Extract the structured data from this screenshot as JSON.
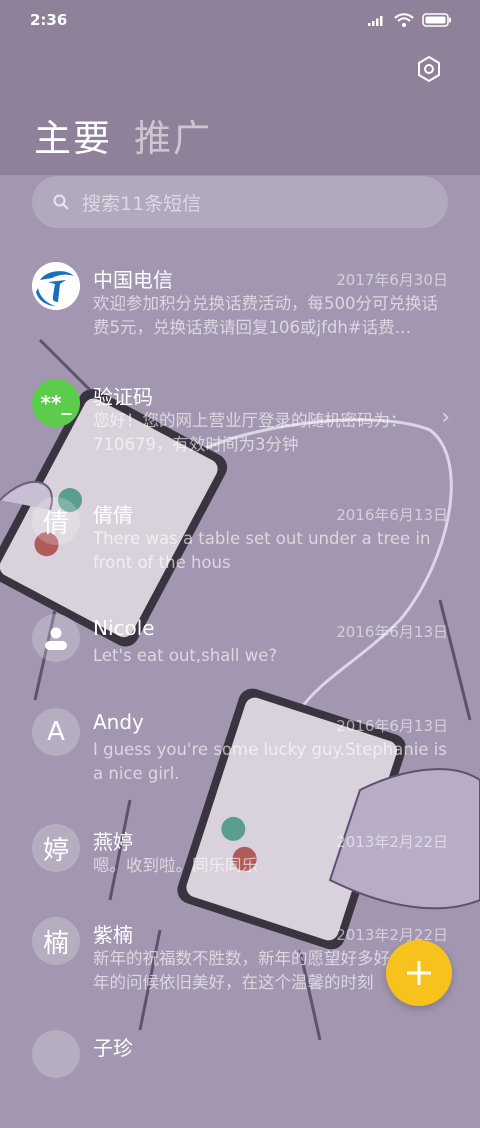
{
  "status_bar": {
    "time": "2:36"
  },
  "tabs": {
    "primary": "主要",
    "promo": "推广"
  },
  "search": {
    "placeholder": "搜索11条短信"
  },
  "conversations": [
    {
      "name": "中国电信",
      "date": "2017年6月30日",
      "preview": "欢迎参加积分兑换话费活动，每500分可兑换话费5元，兑换话费请回复106或jfdh#话费…",
      "avatar_icon": "china-telecom-logo"
    },
    {
      "name": "验证码",
      "date": "",
      "preview": "您好！您的网上营业厅登录的随机密码为：710679，有效时间为3分钟",
      "avatar_text": "**_",
      "avatar_color": "#5bcd4a"
    },
    {
      "name": "倩倩",
      "date": "2016年6月13日",
      "preview": "There was a table set out under a tree in front of the hous",
      "avatar_text": "倩"
    },
    {
      "name": "Nicole",
      "date": "2016年6月13日",
      "preview": "Let's eat out,shall we?",
      "avatar_icon": "person-icon"
    },
    {
      "name": "Andy",
      "date": "2016年6月13日",
      "preview": "I guess you're some lucky guy.Stephanie is a nice girl.",
      "avatar_text": "A"
    },
    {
      "name": "燕婷",
      "date": "2013年2月22日",
      "preview": "嗯。收到啦。同乐同乐",
      "avatar_text": "婷"
    },
    {
      "name": "紫楠",
      "date": "2013年2月22日",
      "preview": "新年的祝福数不胜数，新年的愿望好多好多，新年的问候依旧美好，在这个温馨的时刻",
      "avatar_text": "楠"
    },
    {
      "name": "子珍",
      "date": "",
      "preview": "",
      "avatar_text": ""
    }
  ],
  "colors": {
    "accent_fab": "#f8c21c",
    "verify_avatar": "#5bcd4a",
    "telecom_blue": "#1a6fbd"
  }
}
